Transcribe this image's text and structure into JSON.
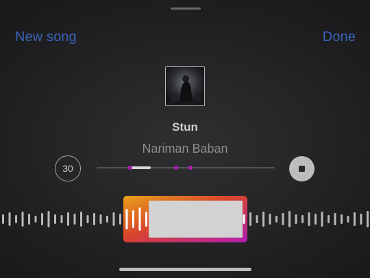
{
  "nav": {
    "left_label": "New song",
    "right_label": "Done"
  },
  "song": {
    "title": "Stun",
    "artist": "Nariman Baban"
  },
  "controls": {
    "skip_label": "30",
    "progress_fraction": 0.12,
    "marker_fractions": [
      0.19,
      0.445,
      0.525
    ]
  },
  "colors": {
    "accent": "#3a63b8",
    "marker": "#b01ab8",
    "selection_gradient": [
      "#e8a21a",
      "#d9442c",
      "#b11fb0"
    ]
  }
}
